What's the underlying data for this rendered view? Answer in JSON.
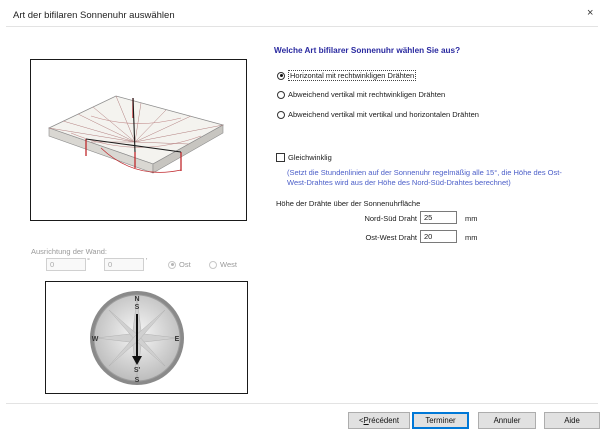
{
  "window": {
    "title": "Art der bifilaren Sonnenuhr auswählen",
    "close_glyph": "×"
  },
  "question": "Welche Art bifilarer Sonnenuhr wählen Sie aus?",
  "types": [
    {
      "label": "Horizontal mit rechtwinkligen Drähten",
      "selected": true
    },
    {
      "label": "Abweichend vertikal mit rechtwinkligen Drähten",
      "selected": false
    },
    {
      "label": "Abweichend vertikal mit vertikal und horizontalen Drähten",
      "selected": false
    }
  ],
  "equiangular": {
    "label": "Gleichwinklig",
    "checked": false,
    "note": "(Setzt die Stundenlinien auf der Sonnenuhr regelmäßig alle 15°, die Höhe des Ost-West-Drahtes wird aus der Höhe des Nord-Süd-Drahtes berechnet)"
  },
  "wire_heights": {
    "heading": "Höhe der Drähte über der Sonnenuhrfläche",
    "ns_label": "Nord-Süd Draht",
    "ns_value": "25",
    "ew_label": "Ost-West Draht",
    "ew_value": "20",
    "unit": "mm"
  },
  "wall": {
    "label": "Ausrichtung der Wand:",
    "deg_value": "0",
    "deg_mark": "°",
    "min_value": "0",
    "min_mark": "'",
    "east_label": "Ost",
    "west_label": "West",
    "east_selected": true
  },
  "compass": {
    "n": "N",
    "s": "S",
    "s_prime": "S'",
    "w": "W",
    "e": "E"
  },
  "buttons": {
    "prev_prefix": "< ",
    "prev_accel": "P",
    "prev_rest": "récédent",
    "finish": "Terminer",
    "cancel": "Annuler",
    "help": "Aide"
  },
  "colors": {
    "question": "#2a2aa0",
    "note": "#4b5ec8",
    "default_button_border": "#0078d7",
    "wire_red": "#c0282d"
  }
}
